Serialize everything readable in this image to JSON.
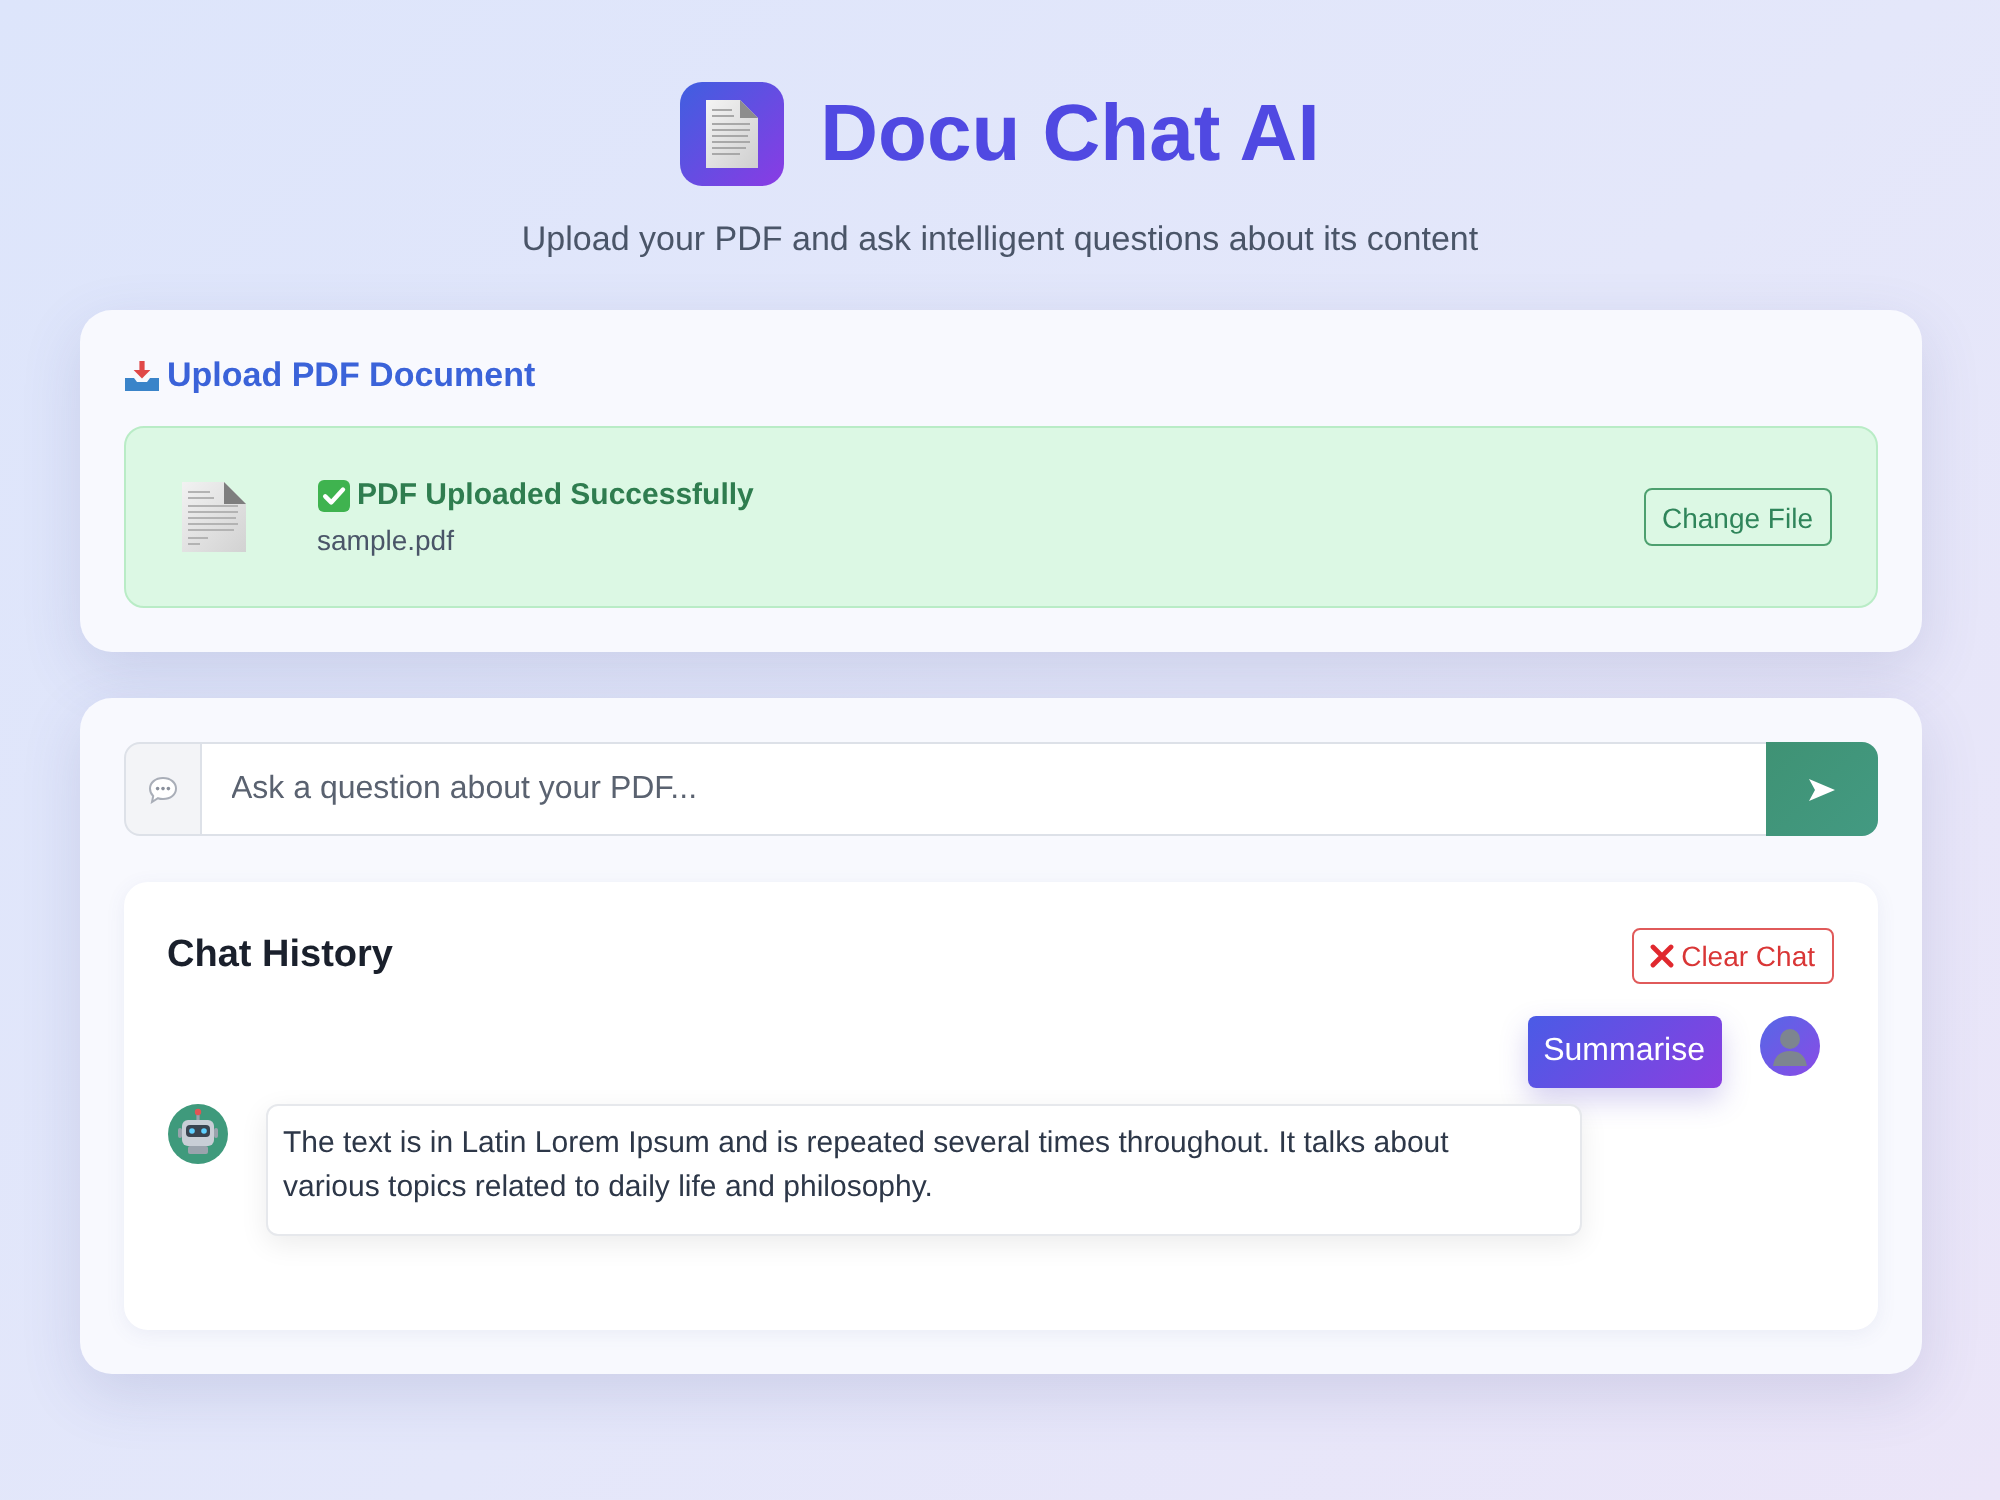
{
  "header": {
    "title": "Docu Chat AI",
    "subtitle": "Upload your PDF and ask intelligent questions about its content"
  },
  "upload": {
    "heading": "Upload PDF Document",
    "status": {
      "uploaded": true,
      "message": "PDF Uploaded Successfully",
      "file_name": "sample.pdf",
      "button": "Change File"
    }
  },
  "chat": {
    "input": {
      "placeholder": "Ask a question about your PDF..."
    },
    "history": {
      "title": "Chat History",
      "clear_button": "Clear Chat",
      "messages": [
        {
          "kind": "user",
          "text": "Summarise"
        },
        {
          "kind": "bot",
          "text": "The text is in Latin Lorem Ipsum and is repeated several times throughout. It talks about various topics related to daily life and philosophy."
        }
      ]
    }
  }
}
